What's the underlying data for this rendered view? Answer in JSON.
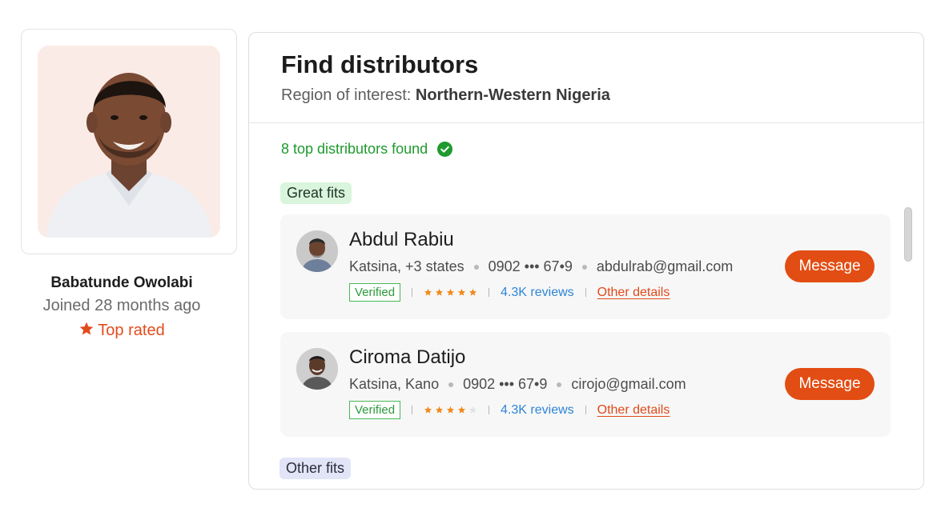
{
  "profile": {
    "name": "Babatunde Owolabi",
    "joined": "Joined 28 months ago",
    "badge": "Top rated",
    "badge_icon": "star-icon"
  },
  "panel": {
    "title": "Find distributors",
    "region_label": "Region of interest:",
    "region_value": "Northern-Western Nigeria",
    "found_text": "8 top distributors found",
    "great_fits_label": "Great fits",
    "other_fits_label": "Other fits"
  },
  "distributors": [
    {
      "name": "Abdul Rabiu",
      "location": "Katsina, +3 states",
      "phone": "0902 ••• 67•9",
      "email": "abdulrab@gmail.com",
      "verified": "Verified",
      "rating": 5,
      "reviews": "4.3K reviews",
      "details": "Other details",
      "action": "Message"
    },
    {
      "name": "Ciroma Datijo",
      "location": "Katsina, Kano",
      "phone": "0902 ••• 67•9",
      "email": "cirojo@gmail.com",
      "verified": "Verified",
      "rating": 4,
      "reviews": "4.3K reviews",
      "details": "Other details",
      "action": "Message"
    }
  ],
  "colors": {
    "accent": "#e24d13",
    "success": "#1e9a2e",
    "link": "#2d86d6",
    "star": "#f08a1c"
  }
}
